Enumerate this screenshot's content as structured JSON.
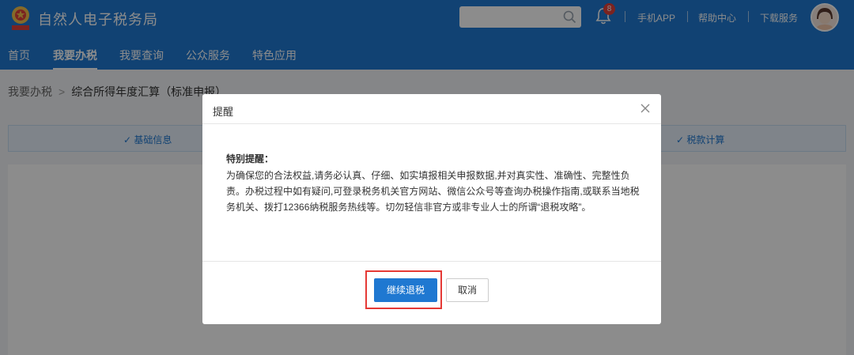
{
  "header": {
    "site_title": "自然人电子税务局",
    "notification_count": "8",
    "links": [
      "手机APP",
      "帮助中心",
      "下载服务"
    ],
    "nav": [
      "首页",
      "我要办税",
      "我要查询",
      "公众服务",
      "特色应用"
    ],
    "active_nav": "我要办税",
    "search": {
      "placeholder": ""
    },
    "brand_color": "#1f78d1"
  },
  "breadcrumb": {
    "root": "我要办税",
    "arrow": ">",
    "current": "综合所得年度汇算（标准申报）"
  },
  "steps": [
    {
      "icon": "check-icon",
      "label": "✓ 基础信息"
    },
    {
      "icon": "check-icon",
      "label": "✓ 税款计算"
    }
  ],
  "modal": {
    "title": "提醒",
    "notice_title": "特别提醒：",
    "notice_body": "为确保您的合法权益,请务必认真、仔细、如实填报相关申报数据,并对真实性、准确性、完整性负责。办税过程中如有疑问,可登录税务机关官方网站、微信公众号等查询办税操作指南,或联系当地税务机关、拨打12366纳税服务热线等。切勿轻信非官方或非专业人士的所谓“退税攻略”。",
    "confirm_label": "继续退税",
    "cancel_label": "取消",
    "highlight_color": "#e53935"
  }
}
